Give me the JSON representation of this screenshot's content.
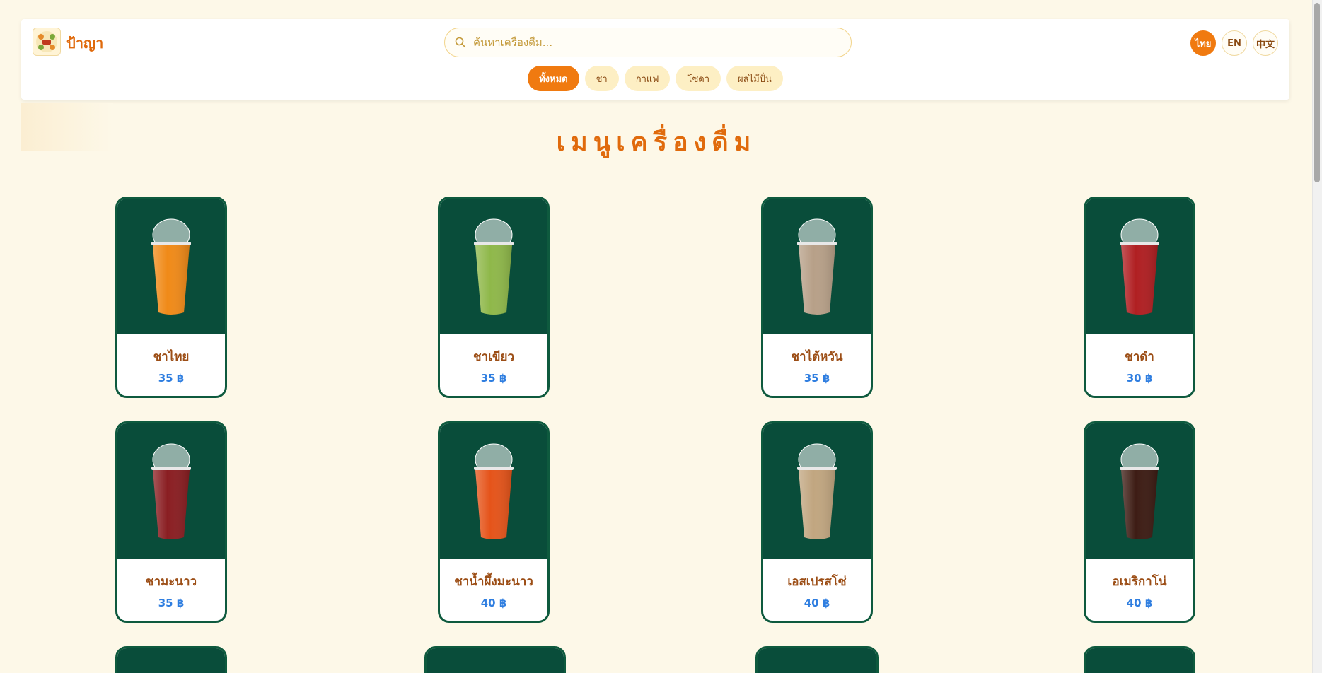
{
  "header": {
    "brand": "ป้าญา",
    "logo_icon": "logo-badge-icon",
    "search_placeholder": "ค้นหาเครื่องดื่ม...",
    "languages": [
      "ไทย",
      "EN",
      "中文"
    ],
    "active_language": "ไทย",
    "categories": [
      "ทั้งหมด",
      "ชา",
      "กาแฟ",
      "โซดา",
      "ผลไม้ปั่น"
    ],
    "active_category": "ทั้งหมด"
  },
  "page_title": "เมนูเครื่องดื่ม",
  "colors": {
    "accent": "#f07a10",
    "card_bg": "#094d3a",
    "name": "#9c4e16",
    "price": "#2f7ee0",
    "page_bg": "#fdf8e8"
  },
  "items": [
    {
      "name": "ชาไทย",
      "price": "35 ฿",
      "drink": "#f08a18"
    },
    {
      "name": "ชาเขียว",
      "price": "35 ฿",
      "drink": "#8fb84a"
    },
    {
      "name": "ชาไต้หวัน",
      "price": "35 ฿",
      "drink": "#b7a088"
    },
    {
      "name": "ชาดำ",
      "price": "30 ฿",
      "drink": "#b01f22"
    },
    {
      "name": "ชามะนาว",
      "price": "35 ฿",
      "drink": "#8a1e22"
    },
    {
      "name": "ชาน้ำผึ้งมะนาว",
      "price": "40 ฿",
      "drink": "#e5541a"
    },
    {
      "name": "เอสเปรสโซ่",
      "price": "40 ฿",
      "drink": "#c1a680"
    },
    {
      "name": "อเมริกาโน่",
      "price": "40 ฿",
      "drink": "#3d1c14"
    }
  ]
}
